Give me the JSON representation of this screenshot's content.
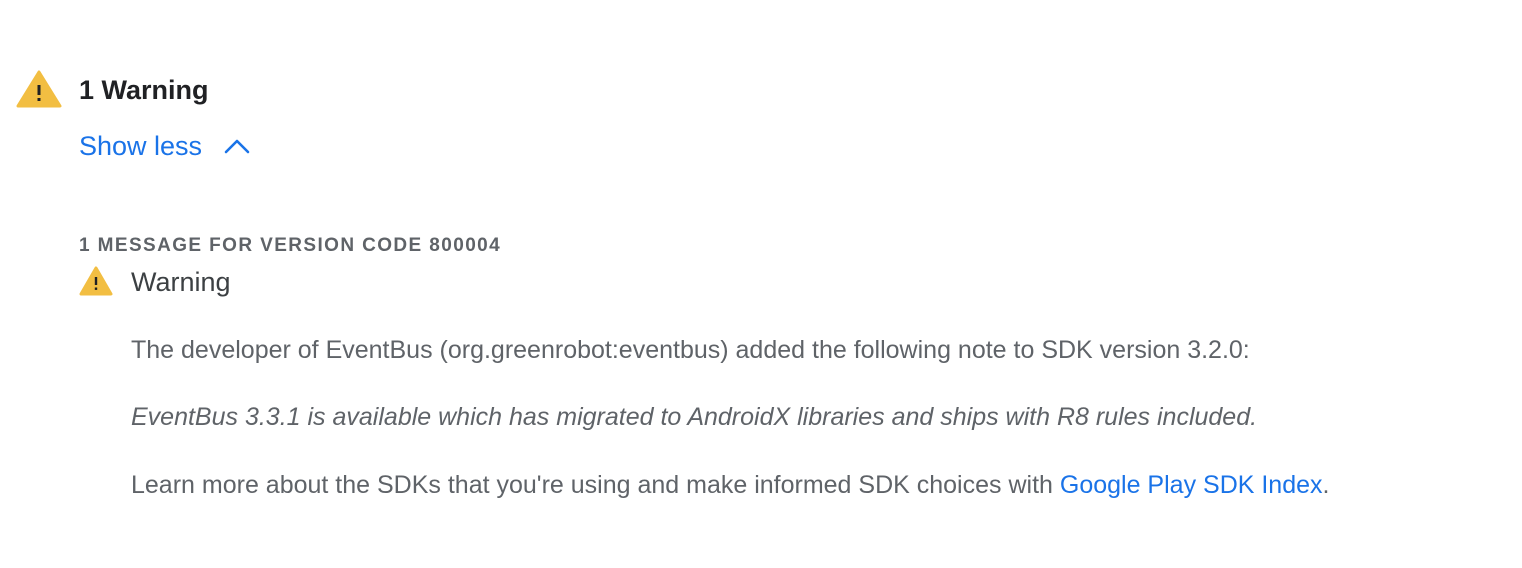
{
  "header": {
    "icon": "warning-triangle-icon",
    "title": "1 Warning",
    "toggle_label": "Show less",
    "toggle_icon": "chevron-up-icon"
  },
  "section": {
    "heading": "1 MESSAGE FOR VERSION CODE 800004"
  },
  "message": {
    "icon": "warning-triangle-icon",
    "title": "Warning",
    "paragraph1": "The developer of EventBus (org.greenrobot:eventbus) added the following note to SDK version 3.2.0:",
    "paragraph2": "EventBus 3.3.1 is available which has migrated to AndroidX libraries and ships with R8 rules included.",
    "paragraph3_prefix": "Learn more about the SDKs that you're using and make informed SDK choices with ",
    "paragraph3_link": "Google Play SDK Index",
    "paragraph3_suffix": "."
  },
  "colors": {
    "warning_yellow": "#f2be42",
    "link_blue": "#1a73e8",
    "text_dark": "#202124",
    "text_gray": "#5f6368"
  }
}
